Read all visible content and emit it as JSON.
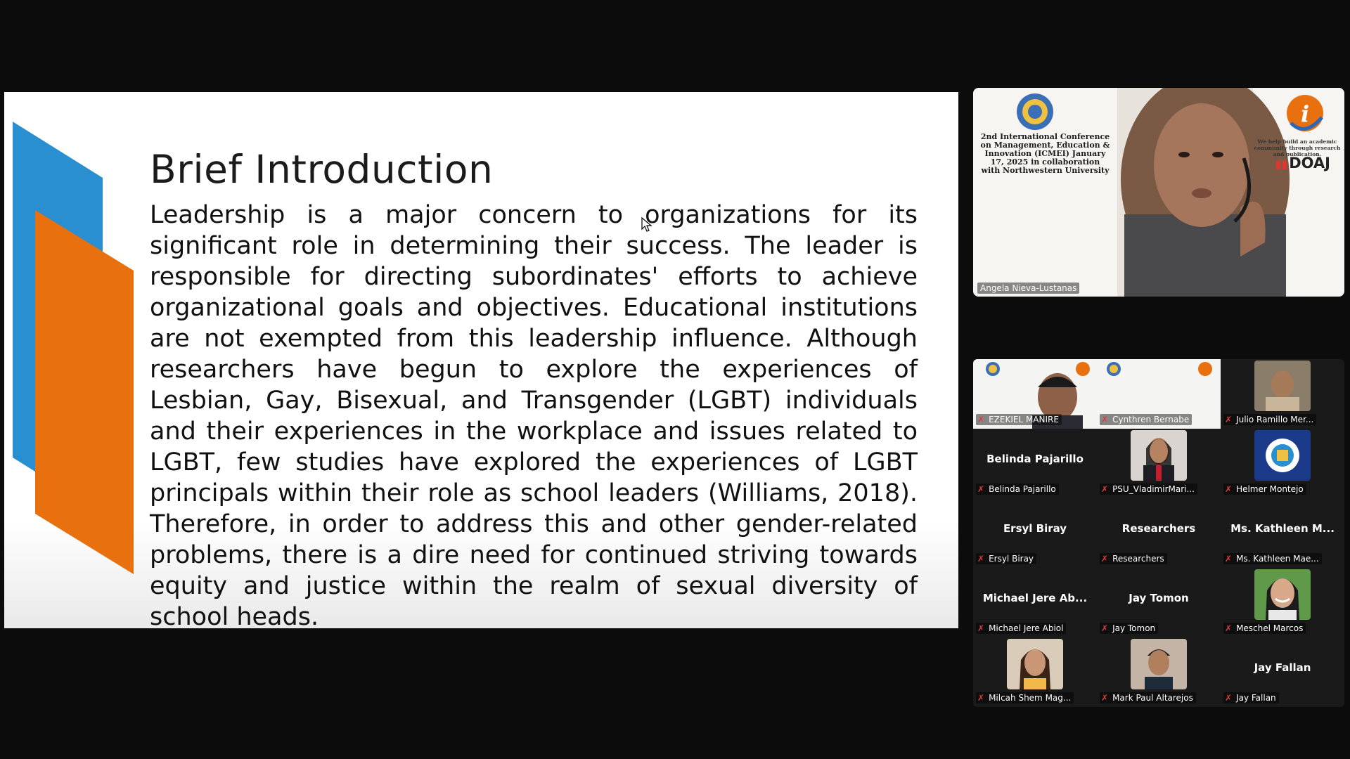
{
  "slide": {
    "title": "Brief Introduction",
    "body": "Leadership is a major concern to organizations for its significant role in determining their success. The leader is responsible for directing subordinates' efforts to achieve organizational goals and objectives. Educational institutions are not exempted from this leadership influence. Although researchers have begun to explore the experiences of Lesbian, Gay, Bisexual, and Transgender (LGBT) individuals and their experiences in the workplace and issues related to LGBT, few studies have explored the experiences of LGBT principals within their role as school leaders (Williams, 2018). Therefore, in order to address this and other gender-related problems, there is a dire need for continued striving towards equity and justice within the realm of sexual diversity of school heads.",
    "colors": {
      "blue": "#2a8fd0",
      "orange": "#e8700f"
    }
  },
  "speaker": {
    "name": "Angela Nieva-Lustanas",
    "conference_text": "2nd International Conference on Management, Education & Innovation (ICMEI) January 17, 2025 in collaboration with Northwestern University",
    "tagline": "We help build an academic community through research and publication.",
    "doaj": "DOAJ"
  },
  "gallery": {
    "mic_icon": "mic-muted-icon",
    "wide_tiles": [
      {
        "label": "EZEKIEL MANIRE"
      },
      {
        "label": "Cynthren Bernabe"
      }
    ],
    "tiles": [
      {
        "label": "Julio Ramillo Mer...",
        "display": ""
      },
      {
        "label": "Belinda Pajarillo",
        "display": "Belinda Pajarillo"
      },
      {
        "label": "PSU_VladimirMari...",
        "display": ""
      },
      {
        "label": "Helmer Montejo",
        "display": ""
      },
      {
        "label": "Ersyl Biray",
        "display": "Ersyl Biray"
      },
      {
        "label": "Researchers",
        "display": "Researchers"
      },
      {
        "label": "Ms. Kathleen Mae...",
        "display": "Ms. Kathleen M..."
      },
      {
        "label": "Michael Jere Abiol",
        "display": "Michael Jere Ab..."
      },
      {
        "label": "Jay Tomon",
        "display": "Jay Tomon"
      },
      {
        "label": "Meschel Marcos",
        "display": ""
      },
      {
        "label": "Milcah Shem Mag...",
        "display": ""
      },
      {
        "label": "Mark Paul Altarejos",
        "display": ""
      },
      {
        "label": "Jay Fallan",
        "display": "Jay Fallan"
      }
    ]
  }
}
